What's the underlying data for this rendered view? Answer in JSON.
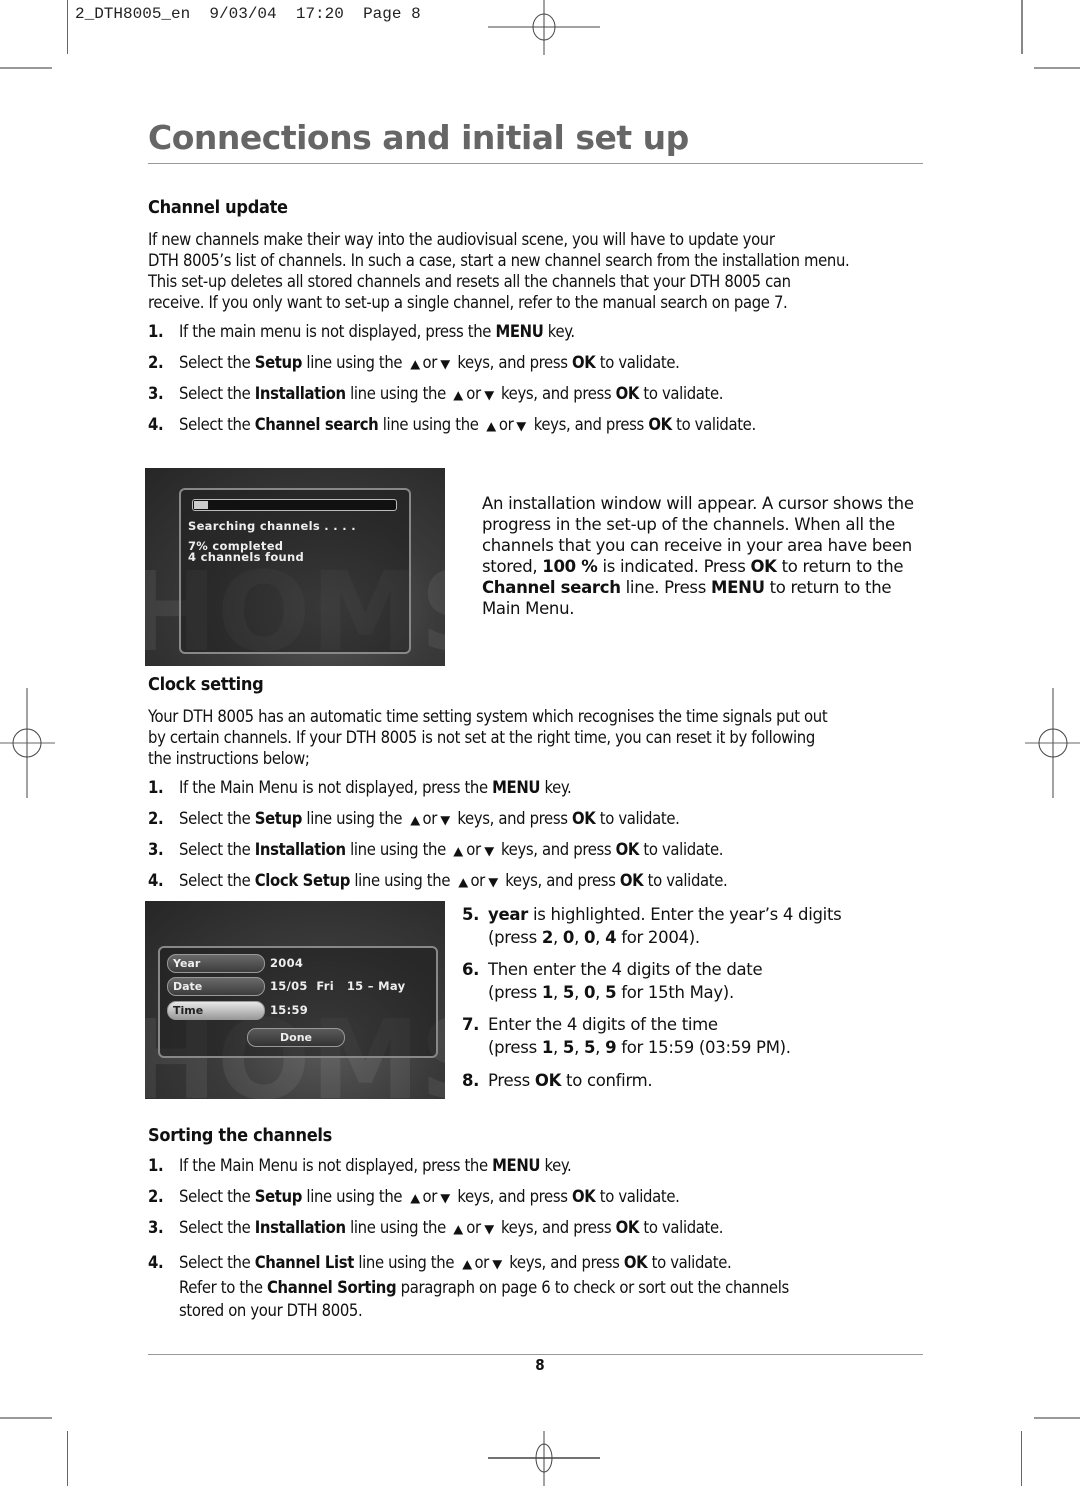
{
  "slug": {
    "file": "2_DTH8005_en",
    "date": "9/03/04",
    "time": "17:20",
    "page_label": "Page 8"
  },
  "title": "Connections and initial set up",
  "arrows": {
    "up": "▲",
    "down": "▼"
  },
  "channel_update": {
    "heading": "Channel update",
    "intro": "If new channels make their way into the audiovisual scene, you will have to update your DTH 8005’s list of channels. In such a case, start a new channel search from the installation menu. This set-up deletes all stored channels and resets all the channels that your DTH 8005 can receive. If you only want to set-up a single channel, refer to the manual search on page 7.",
    "intro_lines": [
      "If new channels make their way into the audiovisual scene, you will have to update your",
      "DTH 8005’s list of channels. In such a case, start a new channel search from the installation menu.",
      "This set-up deletes all stored channels and resets all the channels that your DTH 8005 can",
      "receive. If you only want to set-up a single channel, refer to the manual search on page 7."
    ],
    "steps": [
      {
        "num": "1.",
        "pre": "If the main menu is not displayed, press the ",
        "bold": "MENU",
        "post": " key."
      },
      {
        "num": "2.",
        "pre": "Select the ",
        "bold": "Setup",
        "mid": " line using the ",
        "or": "or",
        "keys": " keys, and press ",
        "ok": "OK",
        "post": " to validate."
      },
      {
        "num": "3.",
        "pre": "Select the ",
        "bold": "Installation",
        "mid": " line using the ",
        "or": "or",
        "keys": " keys, and press ",
        "ok": "OK",
        "post": " to validate."
      },
      {
        "num": "4.",
        "pre": "Select the ",
        "bold": "Channel search",
        "mid": " line using the ",
        "or": "or",
        "keys": " keys, and press ",
        "ok": "OK",
        "post": " to validate."
      }
    ],
    "screen": {
      "searching": "Searching channels . . . .",
      "completed": "7% completed",
      "found": "4 channels found",
      "progress_percent": 7,
      "watermark": "HOMSO"
    },
    "side": {
      "p1": "An installation window will appear. A cursor shows the progress in the set-up of the channels. When all the channels that you can receive in your area have been stored, ",
      "b1": "100 %",
      "p2": " is indicated. Press ",
      "b2": "OK",
      "p3": " to return to the ",
      "b3": "Channel search",
      "p4": " line. Press ",
      "b4": "MENU",
      "p5": " to return to the Main Menu."
    }
  },
  "clock_setting": {
    "heading": "Clock setting",
    "intro_lines": [
      "Your DTH 8005 has an automatic time setting system which recognises the time signals put out",
      "by certain channels. If your DTH 8005 is not set at the right time, you can reset it by following",
      "the instructions below;"
    ],
    "steps": [
      {
        "num": "1.",
        "pre": "If the Main Menu is not displayed, press the ",
        "bold": "MENU",
        "post": " key."
      },
      {
        "num": "2.",
        "pre": "Select the ",
        "bold": "Setup",
        "mid": " line using the ",
        "or": "or",
        "keys": " keys, and press ",
        "ok": "OK",
        "post": " to validate."
      },
      {
        "num": "3.",
        "pre": "Select the ",
        "bold": "Installation",
        "mid": " line using the ",
        "or": "or",
        "keys": " keys, and press ",
        "ok": "OK",
        "post": " to validate."
      },
      {
        "num": "4.",
        "pre": "Select the ",
        "bold": "Clock Setup",
        "mid": " line using the ",
        "or": "or",
        "keys": " keys, and press ",
        "ok": "OK",
        "post": " to validate."
      }
    ],
    "screen": {
      "fields": [
        {
          "label": "Year",
          "value": "2004"
        },
        {
          "label": "Date",
          "value": "15/05  Fri   15 – May"
        },
        {
          "label": "Time",
          "value": "15:59"
        }
      ],
      "done": "Done",
      "watermark": "HOMSO"
    },
    "side_steps": [
      {
        "num": "5.",
        "b0": "year",
        "t1": " is highlighted. Enter the year’s 4 digits",
        "t2": "(press ",
        "d": [
          "2",
          "0",
          "0",
          "4"
        ],
        "t3": " for 2004)."
      },
      {
        "num": "6.",
        "t1": "Then enter the 4 digits of the date",
        "t2": "(press ",
        "d": [
          "1",
          "5",
          "0",
          "5"
        ],
        "t3": " for 15th May)."
      },
      {
        "num": "7.",
        "t1": "Enter the 4 digits of the time",
        "t2": "(press ",
        "d": [
          "1",
          "5",
          "5",
          "9"
        ],
        "t3": " for 15:59 (03:59 PM)."
      },
      {
        "num": "8.",
        "t1": "Press ",
        "ok": "OK",
        "t3": " to confirm."
      }
    ]
  },
  "sorting": {
    "heading": "Sorting the channels",
    "steps": [
      {
        "num": "1.",
        "pre": "If the Main Menu is not displayed, press the ",
        "bold": "MENU",
        "post": " key."
      },
      {
        "num": "2.",
        "pre": "Select the ",
        "bold": "Setup",
        "mid": " line using the ",
        "or": "or",
        "keys": " keys, and press ",
        "ok": "OK",
        "post": " to validate."
      },
      {
        "num": "3.",
        "pre": "Select the ",
        "bold": "Installation",
        "mid": " line using the ",
        "or": "or",
        "keys": " keys, and press ",
        "ok": "OK",
        "post": " to validate."
      },
      {
        "num": "4.",
        "pre": "Select the ",
        "bold": "Channel List",
        "mid": " line using the ",
        "or": "or",
        "keys": " keys, and press ",
        "ok": "OK",
        "post": " to validate."
      }
    ],
    "refer": {
      "pre": "Refer to the ",
      "bold": "Channel Sorting",
      "post": " paragraph on page 6 to check or sort out the channels",
      "line2": "stored on your DTH 8005."
    }
  },
  "page_number": "8"
}
